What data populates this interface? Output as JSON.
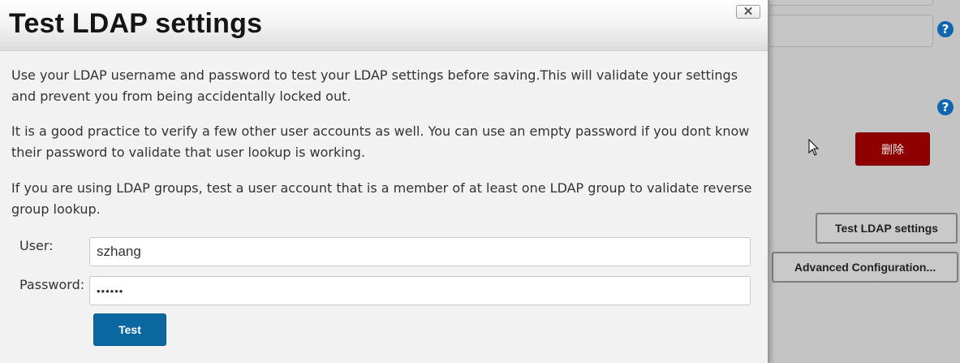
{
  "dialog": {
    "title": "Test LDAP settings",
    "close_symbol": "✕",
    "paragraphs": [
      "Use your LDAP username and password to test your LDAP settings before saving.This will validate your settings and prevent you from being accidentally locked out.",
      "It is a good practice to verify a few other user accounts as well. You can use an empty password if you dont know their password to validate that user lookup is working.",
      "If you are using LDAP groups, test a user account that is a member of at least one LDAP group to validate reverse group lookup."
    ],
    "user_label": "User:",
    "user_value": "szhang",
    "password_label": "Password:",
    "password_value": "••••••",
    "test_button": "Test"
  },
  "background": {
    "help_symbol": "?",
    "delete_button": "删除",
    "test_ldap_button": "Test LDAP settings",
    "advanced_button": "Advanced Configuration..."
  },
  "colors": {
    "primary_button": "#0b679f",
    "danger_button": "#8f0000",
    "help_icon": "#1166b0"
  }
}
